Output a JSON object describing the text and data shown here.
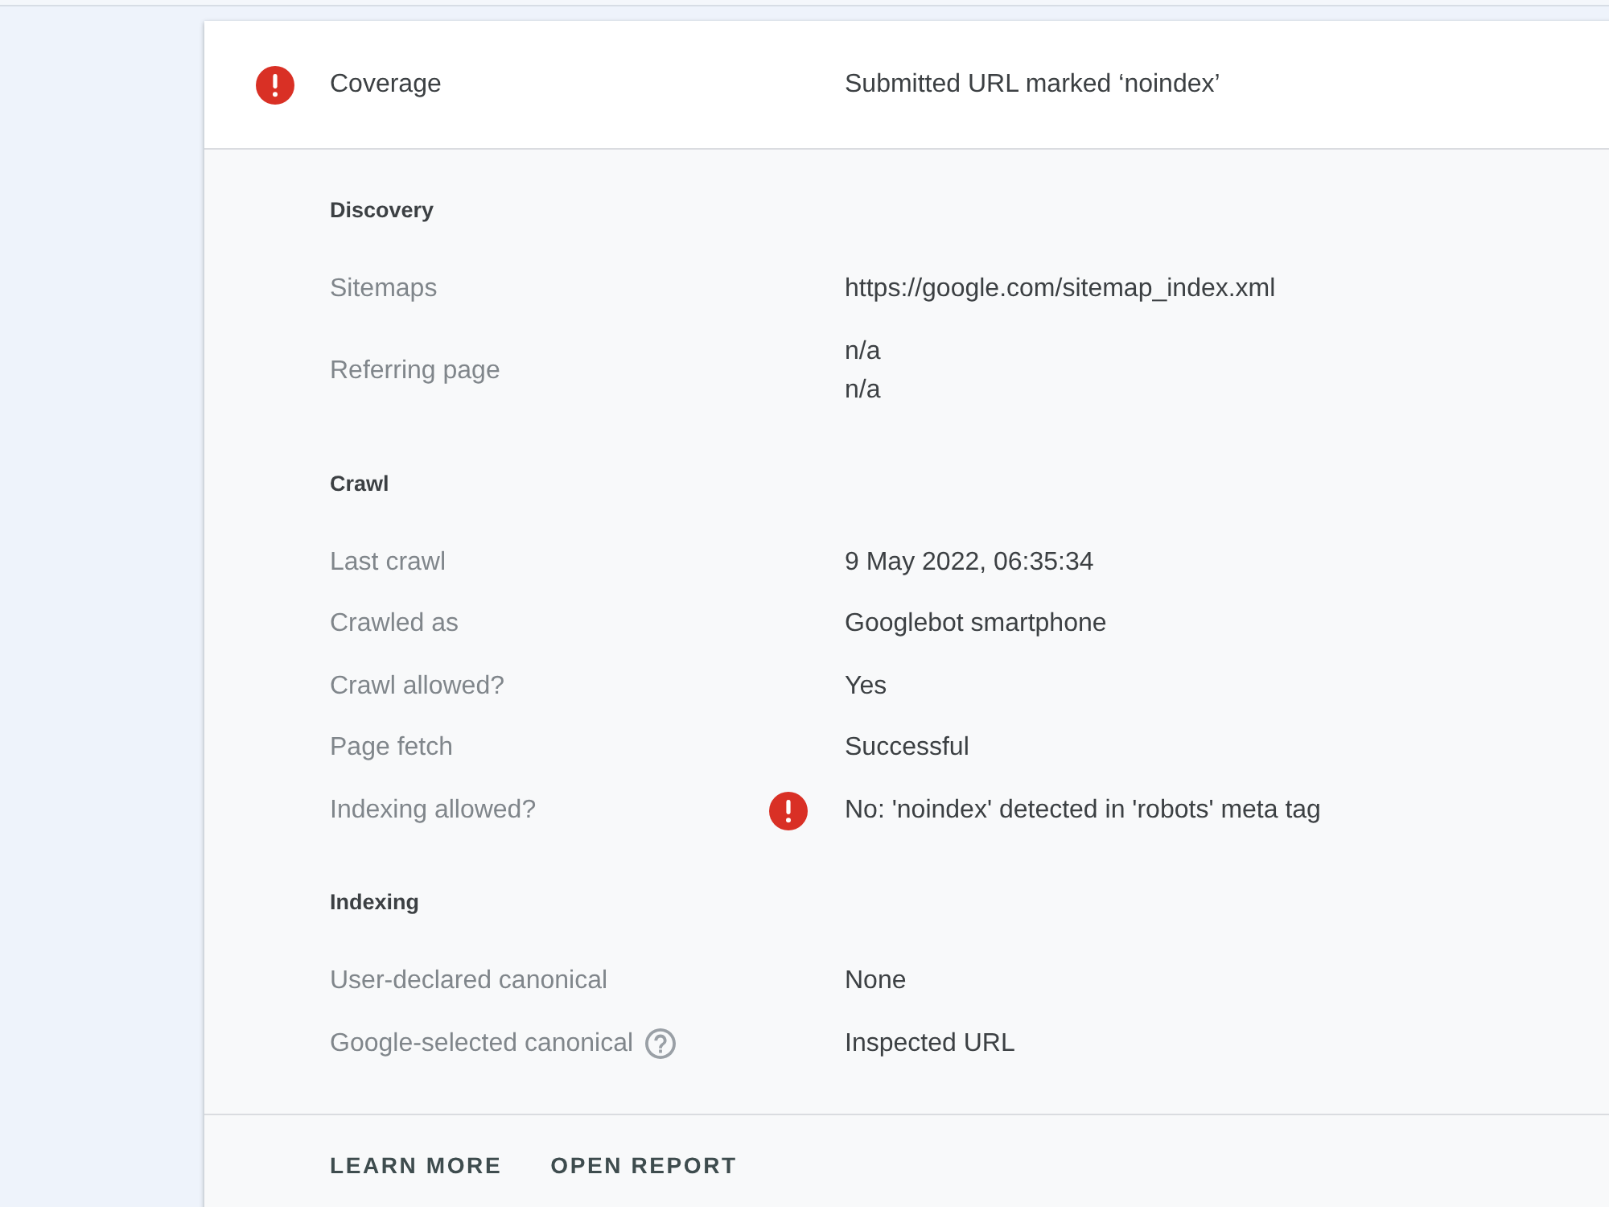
{
  "header": {
    "kind": "error",
    "label": "Coverage",
    "value": "Submitted URL marked ‘noindex’"
  },
  "sections": [
    {
      "title": "Discovery",
      "rows": [
        {
          "kind": "plain",
          "label": "Sitemaps",
          "values": [
            "https://google.com/sitemap_index.xml"
          ]
        },
        {
          "kind": "plain",
          "label": "Referring page",
          "values": [
            "n/a",
            "n/a"
          ]
        }
      ]
    },
    {
      "title": "Crawl",
      "rows": [
        {
          "kind": "plain",
          "label": "Last crawl",
          "values": [
            "9 May 2022, 06:35:34"
          ]
        },
        {
          "kind": "plain",
          "label": "Crawled as",
          "values": [
            "Googlebot smartphone"
          ]
        },
        {
          "kind": "plain",
          "label": "Crawl allowed?",
          "values": [
            "Yes"
          ]
        },
        {
          "kind": "plain",
          "label": "Page fetch",
          "values": [
            "Successful"
          ]
        },
        {
          "kind": "error",
          "label": "Indexing allowed?",
          "values": [
            "No: 'noindex' detected in 'robots' meta tag"
          ]
        }
      ]
    },
    {
      "title": "Indexing",
      "rows": [
        {
          "kind": "plain",
          "label": "User-declared canonical",
          "values": [
            "None"
          ]
        },
        {
          "kind": "help",
          "label": "Google-selected canonical",
          "values": [
            "Inspected URL"
          ]
        }
      ]
    }
  ],
  "actions": [
    "LEARN MORE",
    "OPEN REPORT"
  ]
}
